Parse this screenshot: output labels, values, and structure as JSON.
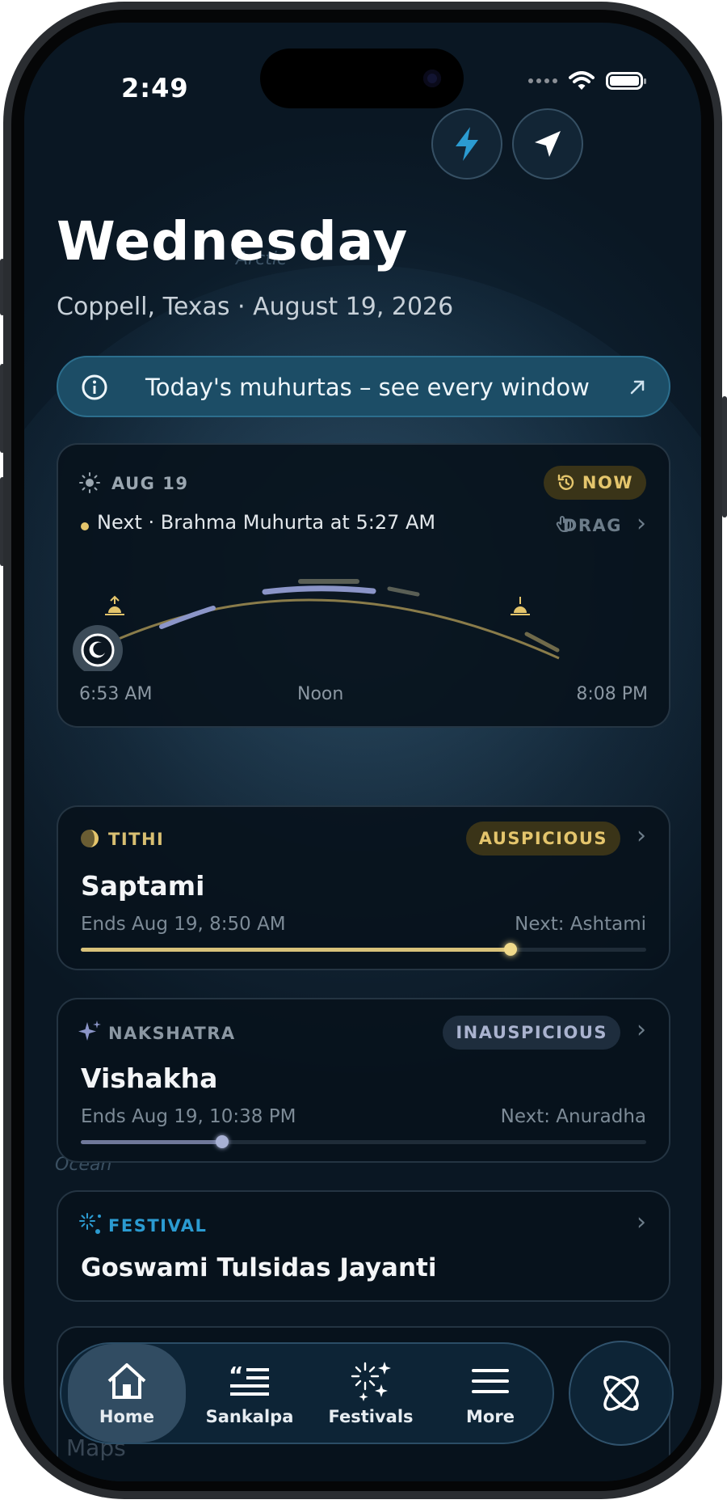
{
  "status_bar": {
    "time": "2:49"
  },
  "header": {
    "day": "Wednesday",
    "location_date": "Coppell, Texas · August 19, 2026",
    "banner_text": "Today's muhurtas – see every window"
  },
  "map_labels": [
    "Arctic",
    "Ocean"
  ],
  "sun_card": {
    "date": "AUG 19",
    "now_label": "NOW",
    "next_text": "Next · Brahma Muhurta at 5:27 AM",
    "drag_label": "DRAG",
    "times": {
      "sunrise": "6:53 AM",
      "noon": "Noon",
      "sunset": "8:08 PM"
    }
  },
  "tithi": {
    "label": "TITHI",
    "status": "AUSPICIOUS",
    "name": "Saptami",
    "ends": "Ends Aug 19, 8:50 AM",
    "next": "Next: Ashtami",
    "progress": 0.76,
    "color": "#d8c27a"
  },
  "nakshatra": {
    "label": "NAKSHATRA",
    "status": "INAUSPICIOUS",
    "name": "Vishakha",
    "ends": "Ends Aug 19, 10:38 PM",
    "next": "Next: Anuradha",
    "progress": 0.25,
    "color": "#8b95b8"
  },
  "festival": {
    "label": "FESTIVAL",
    "name": "Goswami Tulsidas Jayanti"
  },
  "faded_text": "Maps",
  "tabs": [
    {
      "label": "Home",
      "icon": "home-icon",
      "active": true
    },
    {
      "label": "Sankalpa",
      "icon": "quote-list-icon",
      "active": false
    },
    {
      "label": "Festivals",
      "icon": "fireworks-icon",
      "active": false
    },
    {
      "label": "More",
      "icon": "menu-icon",
      "active": false
    }
  ],
  "icons": {
    "quick_action": "lightning-icon",
    "location": "location-arrow-icon",
    "fab": "atom-icon"
  },
  "colors": {
    "accent_gold": "#e4c56c",
    "accent_blue": "#2b9bd1",
    "banner_bg": "#1c4d66"
  }
}
